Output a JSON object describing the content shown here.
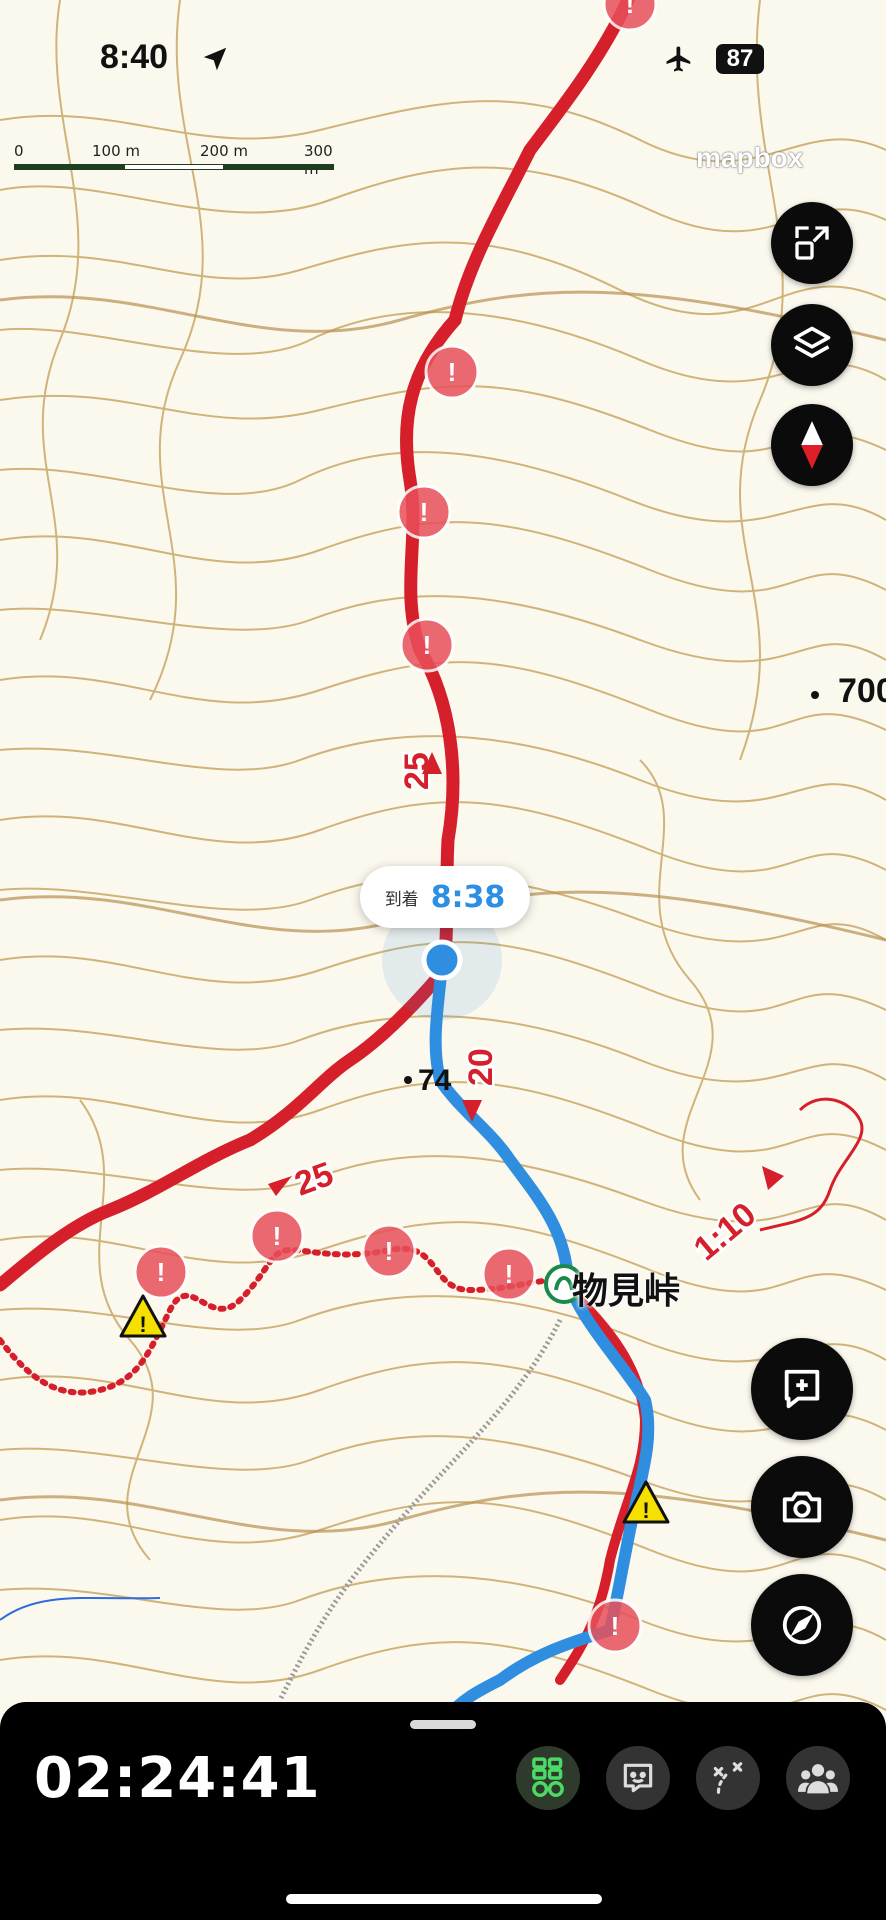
{
  "status_bar": {
    "time": "8:40",
    "battery": "87",
    "icons": [
      "location-arrow-icon",
      "airplane-icon"
    ]
  },
  "scale_bar": {
    "labels": [
      "0",
      "100 m",
      "200 m",
      "300 m"
    ]
  },
  "attribution": {
    "logo_text": "mapbox"
  },
  "map": {
    "arrival_label": "到着",
    "arrival_time": "8:38",
    "place_name": "物見峠",
    "elevation_label": "700",
    "partial_label": "74",
    "route_times": [
      "25",
      "20",
      "25",
      "1:10"
    ],
    "colors": {
      "background": "#fbf8ee",
      "contour": "#c9a765",
      "red_route": "#d51f2b",
      "blue_route": "#2f8ee0",
      "warning_yellow": "#f5e000",
      "hazard_red": "#e8505a"
    }
  },
  "right_controls": [
    {
      "name": "fit-route-button",
      "icon": "fit-route-icon"
    },
    {
      "name": "layers-button",
      "icon": "layers-icon"
    },
    {
      "name": "compass-north-button",
      "icon": "north-arrow-icon"
    }
  ],
  "action_buttons": [
    {
      "name": "add-memo-button",
      "icon": "add-comment-icon"
    },
    {
      "name": "camera-button",
      "icon": "camera-icon"
    },
    {
      "name": "navigation-button",
      "icon": "compass-icon"
    }
  ],
  "bottom_panel": {
    "elapsed_time": "02:24:41",
    "tools": [
      {
        "name": "tool-route-waypoints",
        "icon": "route-waypoints-icon",
        "active": true
      },
      {
        "name": "tool-face-memo",
        "icon": "face-memo-icon",
        "active": false
      },
      {
        "name": "tool-path-edit",
        "icon": "path-edit-icon",
        "active": false
      },
      {
        "name": "tool-group",
        "icon": "group-icon",
        "active": false
      }
    ]
  }
}
